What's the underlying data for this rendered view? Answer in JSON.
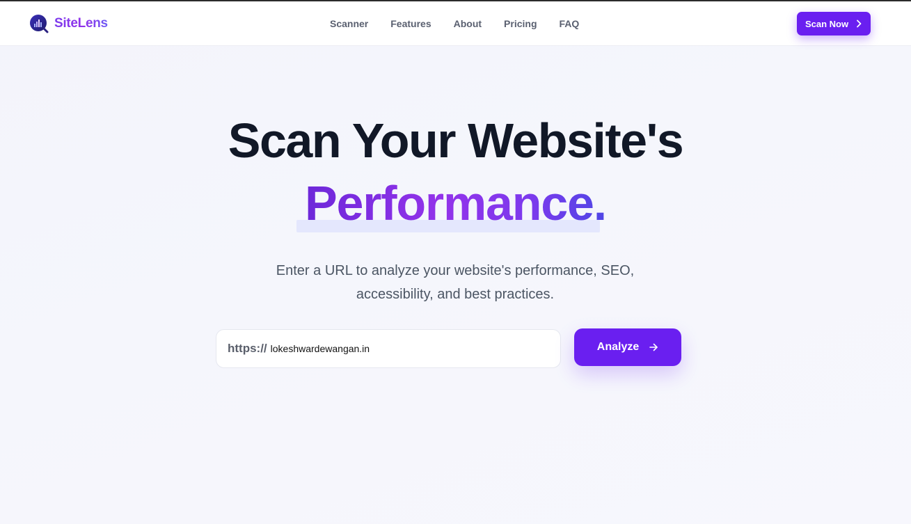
{
  "brand": {
    "name": "SiteLens",
    "logo_icon": "chart-magnifier-icon"
  },
  "nav": {
    "links": [
      "Scanner",
      "Features",
      "About",
      "Pricing",
      "FAQ"
    ],
    "cta_label": "Scan Now",
    "cta_icon": "chevron-right-icon"
  },
  "hero": {
    "title_line1": "Scan Your Website's",
    "title_line2": "Performance.",
    "subtitle_line1": "Enter a URL to analyze your website's performance, SEO,",
    "subtitle_line2": "accessibility, and best practices."
  },
  "form": {
    "prefix": "https://",
    "url_value": "lokeshwardewangan.in",
    "button_label": "Analyze",
    "button_icon": "arrow-right-icon"
  },
  "colors": {
    "accent": "#6a1ff0",
    "heading": "#111827",
    "nav_text": "#5a6070",
    "gradient": [
      "#6d28d9",
      "#9333ea",
      "#4f46e5"
    ]
  }
}
